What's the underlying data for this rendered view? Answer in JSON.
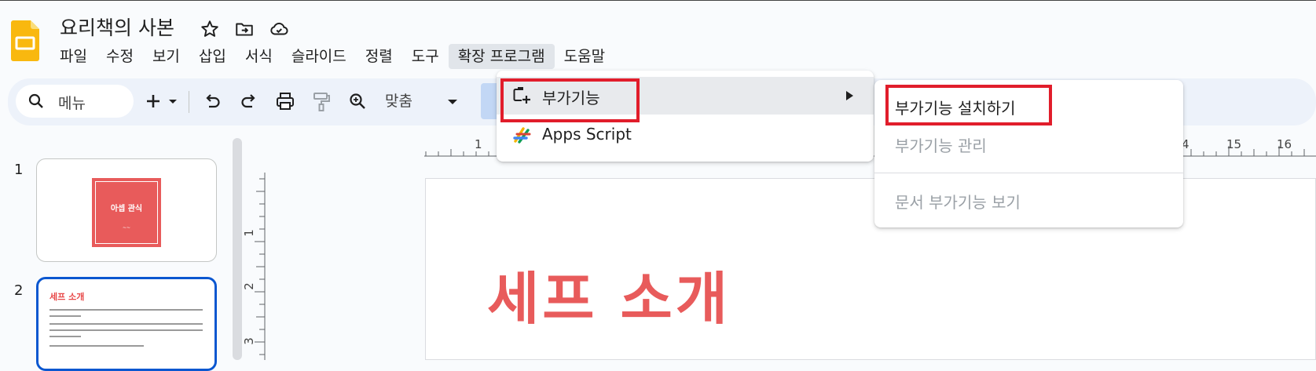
{
  "app": {
    "title": "요리책의 사본",
    "icons": [
      "star-icon",
      "move-to-folder-icon",
      "cloud-saved-icon"
    ]
  },
  "menubar": {
    "items": [
      "파일",
      "수정",
      "보기",
      "삽입",
      "서식",
      "슬라이드",
      "정렬",
      "도구",
      "확장 프로그램",
      "도움말"
    ],
    "active": "확장 프로그램"
  },
  "toolbar": {
    "search_label": "메뉴",
    "zoom_label": "맞춤"
  },
  "filmstrip": {
    "slides": [
      {
        "number": "1",
        "title": "아셉 관식",
        "subtitle": "~~"
      },
      {
        "number": "2",
        "title": "세프 소개"
      }
    ]
  },
  "ruler": {
    "horizontal": [
      "1",
      "4",
      "15",
      "16"
    ],
    "vertical": [
      "1",
      "2",
      "3"
    ]
  },
  "slide": {
    "heading": "세프 소개"
  },
  "extensions_menu": {
    "items": [
      {
        "label": "부가기능",
        "icon": "add-on-icon",
        "has_submenu": true
      },
      {
        "label": "Apps Script",
        "icon": "apps-script-icon"
      }
    ]
  },
  "addons_submenu": {
    "items": [
      {
        "label": "부가기능 설치하기",
        "enabled": true
      },
      {
        "label": "부가기능 관리",
        "enabled": false
      },
      {
        "label": "문서 부가기능 보기",
        "enabled": false
      }
    ]
  },
  "colors": {
    "accent": "#0b57d0",
    "highlight_box": "#e11d2b",
    "slide_title": "#e85b5b",
    "logo": "#f9b80f"
  }
}
